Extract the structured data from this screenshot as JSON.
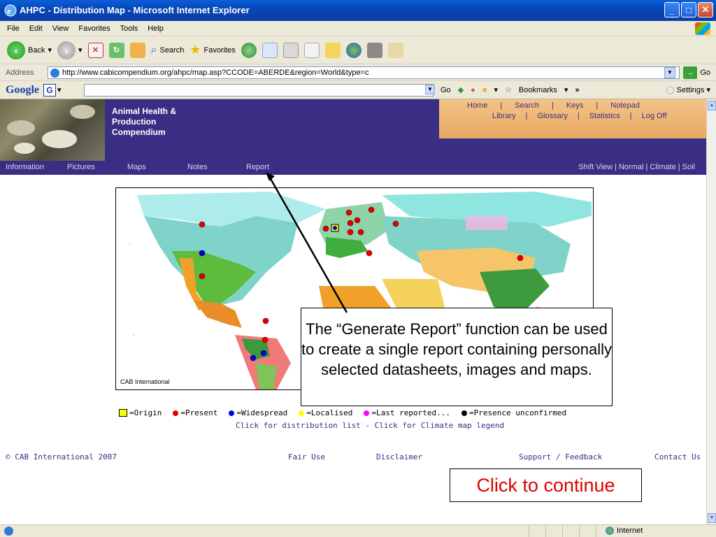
{
  "window": {
    "title": "AHPC - Distribution Map - Microsoft Internet Explorer"
  },
  "menu": [
    "File",
    "Edit",
    "View",
    "Favorites",
    "Tools",
    "Help"
  ],
  "toolbar": {
    "back": "Back",
    "search": "Search",
    "favorites": "Favorites"
  },
  "address": {
    "label": "Address",
    "url": "http://www.cabicompendium.org/ahpc/map.asp?CCODE=ABERDE&region=World&type=c",
    "go": "Go"
  },
  "googlebar": {
    "logo": "Google",
    "g": "G",
    "go": "Go",
    "bookmarks": "Bookmarks",
    "chevrons": "»",
    "settings": "Settings"
  },
  "banner": {
    "app_name": [
      "Animal Health &",
      "Production",
      "Compendium"
    ],
    "links_row1": [
      "Home",
      "Search",
      "Keys",
      "Notepad"
    ],
    "links_row2": [
      "Library",
      "Glossary",
      "Statistics",
      "Log Off"
    ]
  },
  "subnav": {
    "items": [
      "Information",
      "Pictures",
      "Maps",
      "Notes",
      "Report"
    ],
    "right": "Shift View | Normal | Climate | Soil"
  },
  "map": {
    "caption": "CAB International"
  },
  "legend": {
    "items": [
      {
        "label": "=Origin",
        "color": "#ffff00"
      },
      {
        "label": "=Present",
        "color": "#e00000"
      },
      {
        "label": "=Widespread",
        "color": "#0000e0"
      },
      {
        "label": "=Localised",
        "color": "#ffff00"
      },
      {
        "label": "=Last reported...",
        "color": "#ff00ff"
      },
      {
        "label": "=Presence unconfirmed",
        "color": "#000000"
      }
    ],
    "links": "Click for distribution list - Click for Climate map legend"
  },
  "footer": {
    "copyright": "© CAB International 2007",
    "fair_use": "Fair Use",
    "disclaimer": "Disclaimer",
    "support": "Support / Feedback",
    "contact": "Contact Us"
  },
  "callout": "The “Generate Report” function can be used to create a single report containing personally selected datasheets, images and maps.",
  "continue": "Click to continue",
  "statusbar": {
    "zone": "Internet"
  }
}
